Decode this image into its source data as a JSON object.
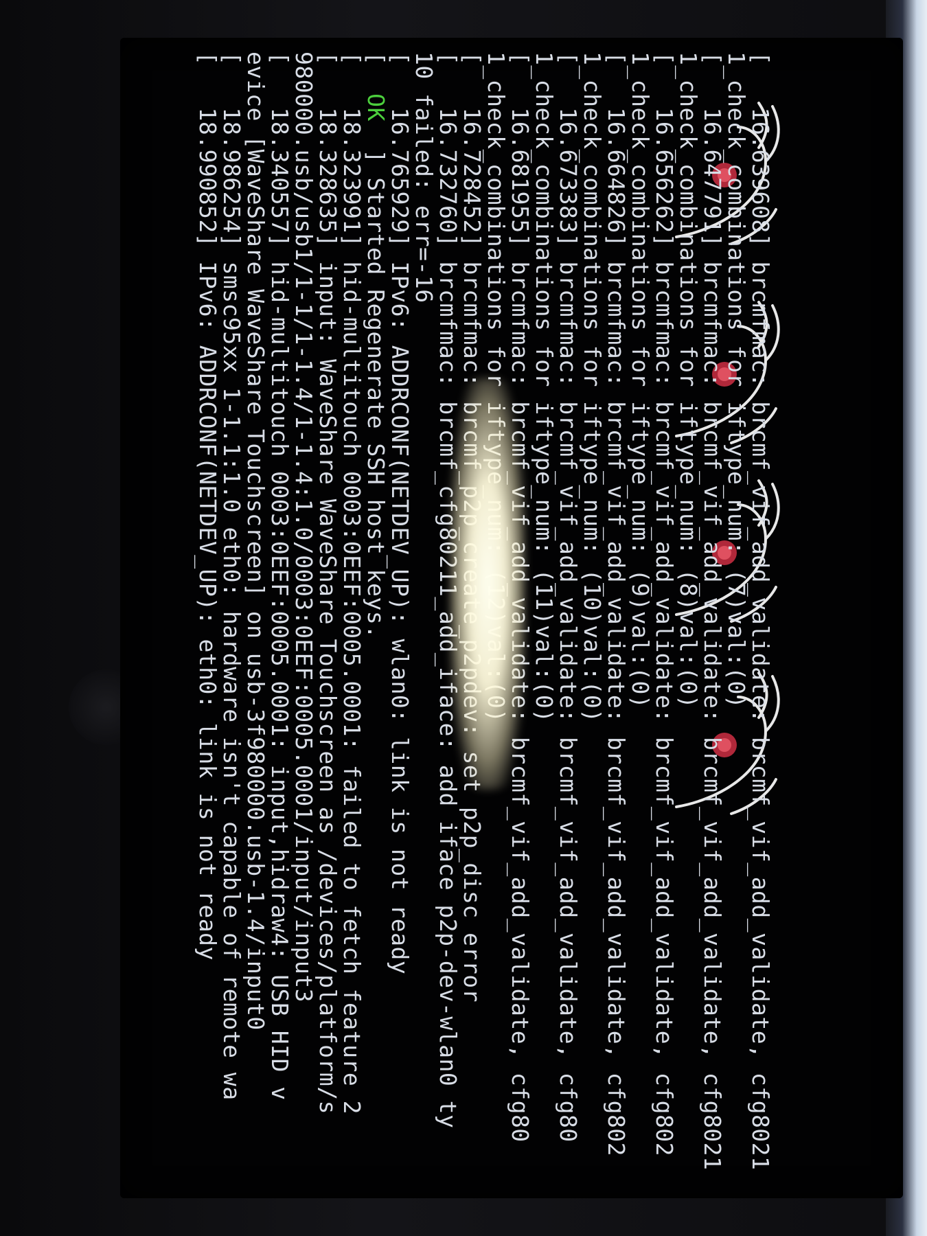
{
  "console": {
    "lines": [
      {
        "text": "[   16.639608] brcmfmac: brcmf_vif_add_validate: brcmf_vif_add_validate, cfg8021"
      },
      {
        "text": "1_check_combinations for iftype_num: (7)val:(0)"
      },
      {
        "text": "[   16.647791] brcmfmac: brcmf_vif_add_validate: brcmf_vif_add_validate, cfg8021"
      },
      {
        "text": "1_check_combinations for iftype_num: (8)val:(0)"
      },
      {
        "text": "[   16.656262] brcmfmac: brcmf_vif_add_validate: brcmf_vif_add_validate, cfg802"
      },
      {
        "text": "1_check_combinations for iftype_num: (9)val:(0)"
      },
      {
        "text": "[   16.664826] brcmfmac: brcmf_vif_add_validate: brcmf_vif_add_validate, cfg802"
      },
      {
        "text": "1_check_combinations for iftype_num: (10)val:(0)"
      },
      {
        "text": "[   16.673383] brcmfmac: brcmf_vif_add_validate: brcmf_vif_add_validate, cfg80"
      },
      {
        "text": "1_check_combinations for iftype_num: (11)val:(0)"
      },
      {
        "text": "[   16.681955] brcmfmac: brcmf_vif_add_validate: brcmf_vif_add_validate, cfg80"
      },
      {
        "text": "1_check_combinations for iftype_num: (12)val:(0)"
      },
      {
        "text": "[   16.728452] brcmfmac: brcmf_p2p_create_p2pdev: set p2p_disc error"
      },
      {
        "text": "[   16.732760] brcmfmac: brcmf_cfg80211_add_iface: add iface p2p-dev-wlan0 ty"
      },
      {
        "text": "10 failed: err=-16"
      },
      {
        "text": "[   16.765929] IPv6: ADDRCONF(NETDEV_UP): wlan0: link is not ready"
      },
      {
        "text": "[  OK  ] Started Regenerate SSH host keys.",
        "ok": true
      },
      {
        "text": "[   18.323991] hid-multitouch 0003:0EEF:0005.0001: failed to fetch feature 2"
      },
      {
        "text": "[   18.328635] input: WaveShare WaveShare Touchscreen as /devices/platform/s"
      },
      {
        "text": "980000.usb/usb1/1-1/1-1.4/1-1.4:1.0/0003:0EEF:0005.0001/input/input3"
      },
      {
        "text": "[   18.340557] hid-multitouch 0003:0EEF:0005.0001: input,hidraw4: USB HID v"
      },
      {
        "text": "evice [WaveShare WaveShare Touchscreen] on usb-3f980000.usb-1.4/input0"
      },
      {
        "text": "[   18.986254] smsc95xx 1-1.1:1.0 eth0: hardware isn't capable of remote wa"
      },
      {
        "text": "[   18.990852] IPv6: ADDRCONF(NETDEV_UP): eth0: link is not ready"
      }
    ]
  },
  "colors": {
    "text": "#d8dde6",
    "ok": "#4ccf3d",
    "background": "#020203"
  },
  "wallpaper": {
    "icon": "kali-dragon-raspberry-icon",
    "count": 4
  }
}
